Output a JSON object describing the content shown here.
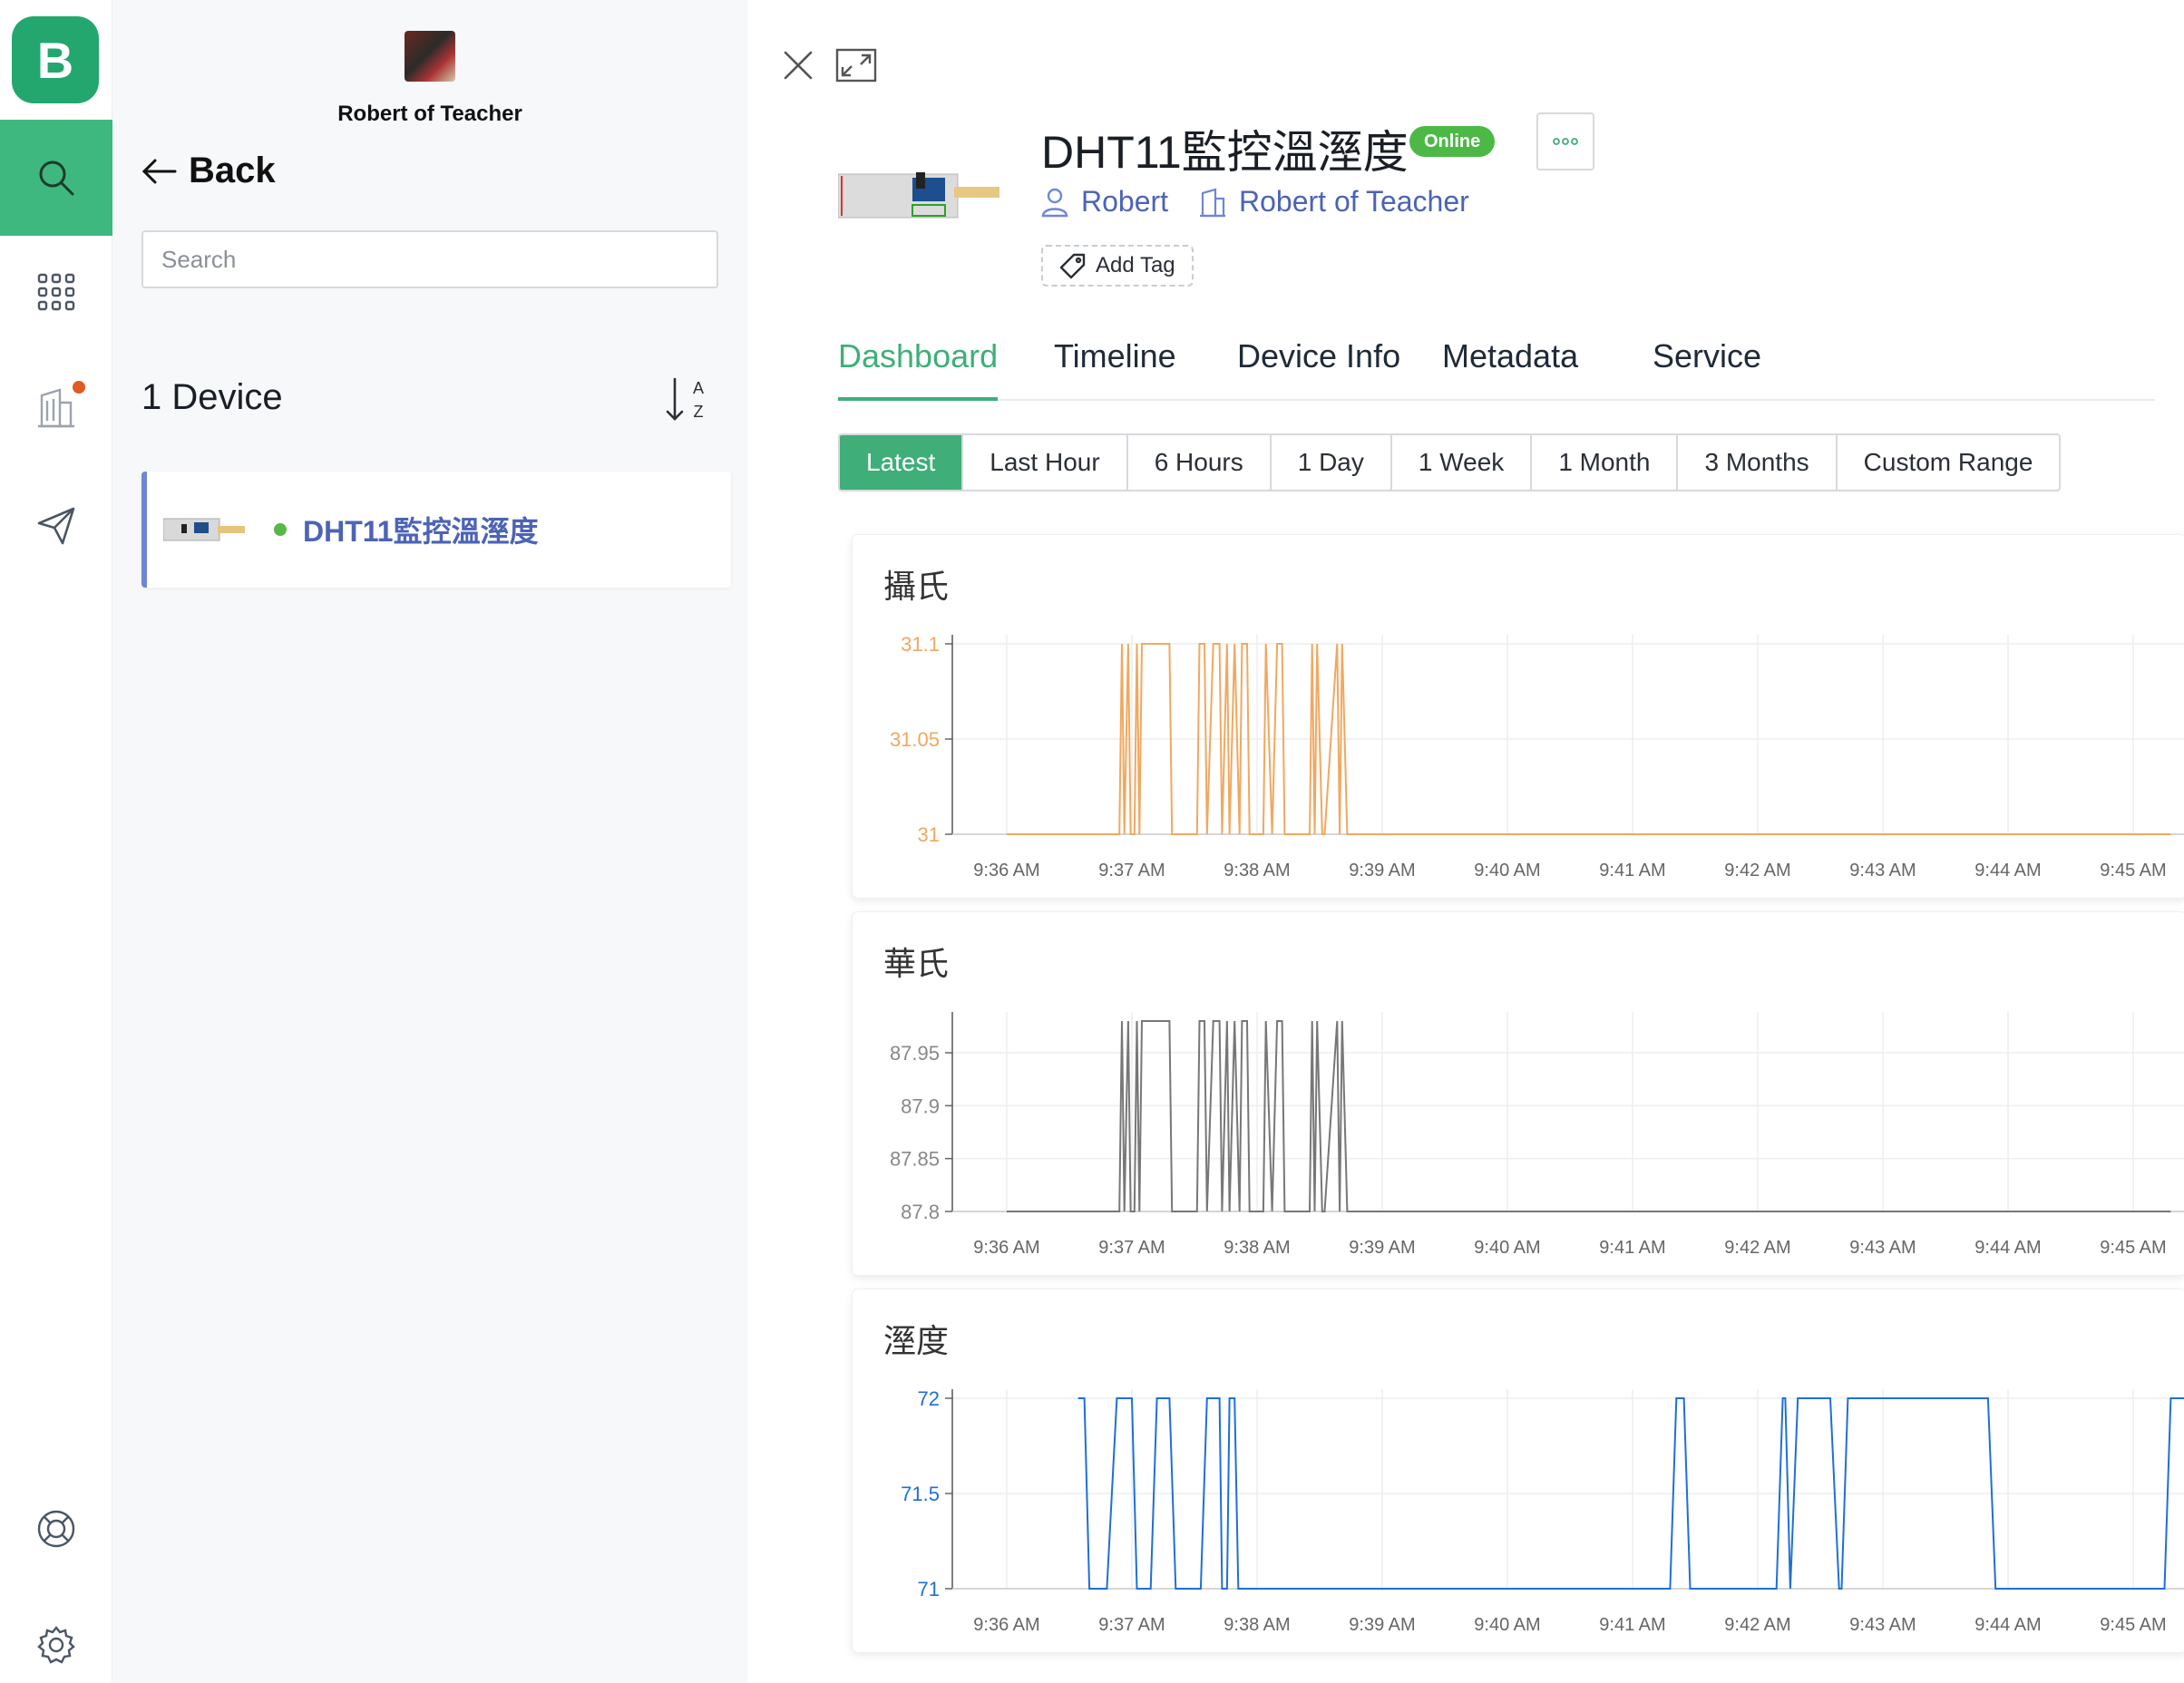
{
  "org": {
    "name": "Robert of Teacher"
  },
  "nav": {
    "back_label": "Back"
  },
  "search": {
    "placeholder": "Search"
  },
  "device_list": {
    "count_label": "1 Device",
    "sort_letters": [
      "A",
      "Z"
    ],
    "items": [
      {
        "name": "DHT11監控溫溼度",
        "status": "online"
      }
    ]
  },
  "device": {
    "title": "DHT11監控溫溼度",
    "status_badge": "Online",
    "owner": "Robert",
    "organization": "Robert of Teacher",
    "add_tag_label": "Add Tag"
  },
  "tabs": [
    "Dashboard",
    "Timeline",
    "Device Info",
    "Metadata",
    "Service"
  ],
  "active_tab": "Dashboard",
  "time_ranges": [
    "Latest",
    "Last Hour",
    "6 Hours",
    "1 Day",
    "1 Week",
    "1 Month",
    "3 Months",
    "Custom Range"
  ],
  "active_range": "Latest",
  "colors": {
    "brand": "#23a76f",
    "accent": "#3fae79",
    "link": "#4c63b6",
    "online": "#4cb947",
    "alert_dot": "#e05a24"
  },
  "icons": [
    "search-icon",
    "apps-grid-icon",
    "building-icon",
    "send-icon",
    "help-lifebuoy-icon",
    "settings-gear-icon",
    "close-icon",
    "expand-icon",
    "more-icon",
    "user-icon",
    "tag-icon",
    "sort-az-icon",
    "arrow-left-icon"
  ],
  "chart_data": [
    {
      "type": "line",
      "title": "攝氏",
      "color": "#f0a860",
      "x": [
        "9:36 AM",
        "9:37 AM",
        "9:38 AM",
        "9:39 AM",
        "9:40 AM",
        "9:41 AM",
        "9:42 AM",
        "9:43 AM",
        "9:44 AM",
        "9:45 AM"
      ],
      "yticks": [
        "31",
        "31.05",
        "31.1"
      ],
      "ylim": [
        31,
        31.1
      ],
      "grid": true,
      "series": [
        {
          "t": [
            0.0,
            0.8,
            0.9,
            0.92,
            0.94,
            0.97,
            0.99,
            1.02,
            1.04,
            1.06,
            1.08,
            1.3,
            1.32,
            1.52,
            1.54,
            1.58,
            1.6,
            1.65,
            1.7,
            1.72,
            1.76,
            1.78,
            1.82,
            1.86,
            1.88,
            1.92,
            1.94,
            2.05,
            2.07,
            2.12,
            2.16,
            2.2,
            2.22,
            2.42,
            2.44,
            2.46,
            2.48,
            2.52,
            2.54,
            2.64,
            2.66,
            2.68,
            2.72,
            2.95,
            9.3
          ],
          "y": [
            31,
            31,
            31,
            31.1,
            31,
            31.1,
            31,
            31,
            31.1,
            31,
            31.1,
            31.1,
            31,
            31,
            31.1,
            31.1,
            31,
            31.1,
            31.1,
            31,
            31.1,
            31,
            31.1,
            31,
            31.1,
            31.1,
            31,
            31,
            31.1,
            31,
            31.1,
            31.1,
            31,
            31,
            31.1,
            31,
            31.1,
            31,
            31,
            31.1,
            31,
            31.1,
            31,
            31,
            31
          ]
        }
      ]
    },
    {
      "type": "line",
      "title": "華氏",
      "color": "#777777",
      "x": [
        "9:36 AM",
        "9:37 AM",
        "9:38 AM",
        "9:39 AM",
        "9:40 AM",
        "9:41 AM",
        "9:42 AM",
        "9:43 AM",
        "9:44 AM",
        "9:45 AM"
      ],
      "yticks": [
        "87.8",
        "87.85",
        "87.9",
        "87.95"
      ],
      "ylim": [
        87.8,
        87.98
      ],
      "grid": true,
      "series": [
        {
          "t": [
            0.0,
            0.8,
            0.9,
            0.92,
            0.94,
            0.97,
            0.99,
            1.02,
            1.04,
            1.06,
            1.08,
            1.3,
            1.32,
            1.52,
            1.54,
            1.58,
            1.6,
            1.65,
            1.7,
            1.72,
            1.76,
            1.78,
            1.82,
            1.86,
            1.88,
            1.92,
            1.94,
            2.05,
            2.07,
            2.12,
            2.16,
            2.2,
            2.22,
            2.42,
            2.44,
            2.46,
            2.48,
            2.52,
            2.54,
            2.64,
            2.66,
            2.68,
            2.72,
            2.95,
            9.3
          ],
          "y": [
            87.8,
            87.8,
            87.8,
            87.98,
            87.8,
            87.98,
            87.8,
            87.8,
            87.98,
            87.8,
            87.98,
            87.98,
            87.8,
            87.8,
            87.98,
            87.98,
            87.8,
            87.98,
            87.98,
            87.8,
            87.98,
            87.8,
            87.98,
            87.8,
            87.98,
            87.98,
            87.8,
            87.8,
            87.98,
            87.8,
            87.98,
            87.98,
            87.8,
            87.8,
            87.98,
            87.8,
            87.98,
            87.8,
            87.8,
            87.98,
            87.8,
            87.98,
            87.8,
            87.8,
            87.8
          ]
        }
      ]
    },
    {
      "type": "line",
      "title": "溼度",
      "color": "#1f6fd6",
      "x": [
        "9:36 AM",
        "9:37 AM",
        "9:38 AM",
        "9:39 AM",
        "9:40 AM",
        "9:41 AM",
        "9:42 AM",
        "9:43 AM",
        "9:44 AM",
        "9:45 AM"
      ],
      "yticks": [
        "71",
        "71.5",
        "72"
      ],
      "ylim": [
        71,
        72
      ],
      "grid": true,
      "series": [
        {
          "t": [
            0.57,
            0.62,
            0.66,
            0.8,
            0.88,
            1.0,
            1.04,
            1.15,
            1.2,
            1.3,
            1.35,
            1.55,
            1.6,
            1.7,
            1.72,
            1.76,
            1.78,
            1.82,
            1.85,
            1.87,
            5.3,
            5.35,
            5.41,
            5.46,
            6.15,
            6.2,
            6.22,
            6.26,
            6.32,
            6.58,
            6.65,
            6.67,
            6.72,
            6.79,
            7.84,
            7.9,
            9.25,
            9.3,
            9.35,
            9.6
          ],
          "y": [
            72,
            72,
            71,
            71,
            72,
            72,
            71,
            71,
            72,
            72,
            71,
            71,
            72,
            72,
            71,
            71,
            72,
            72,
            71,
            71,
            71,
            72,
            72,
            71,
            71,
            72,
            72,
            71,
            72,
            72,
            71,
            71,
            72,
            72,
            72,
            71,
            71,
            72,
            72,
            72
          ]
        }
      ]
    }
  ]
}
